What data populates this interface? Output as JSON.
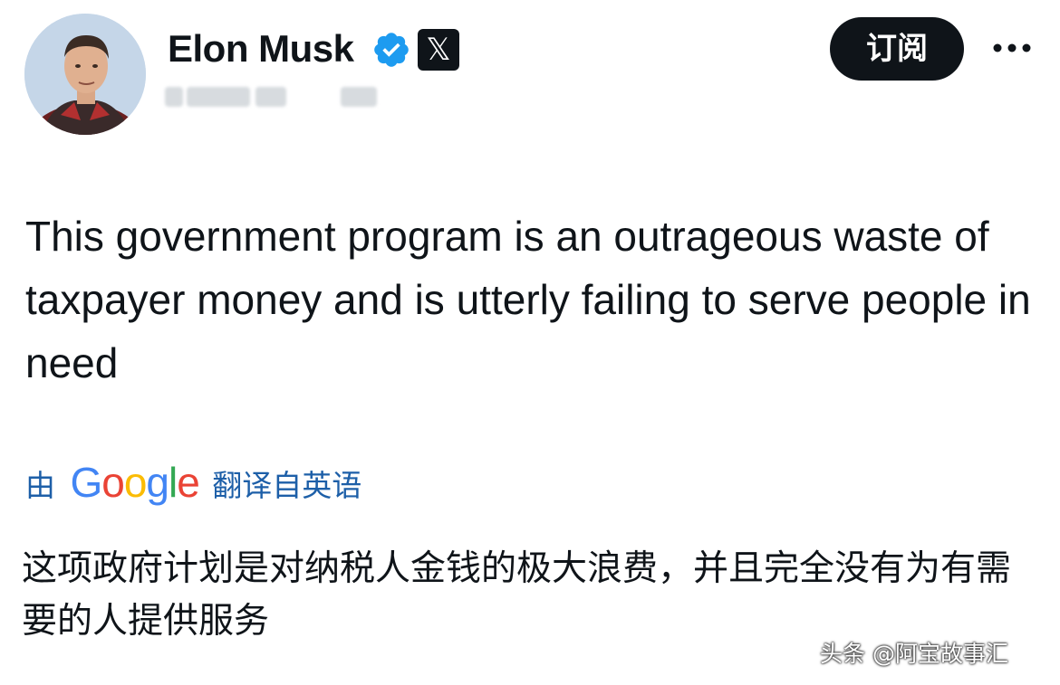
{
  "post": {
    "author": {
      "display_name": "Elon Musk",
      "verified_icon": "verified-badge-icon",
      "affiliation_badge_icon": "x-logo-icon",
      "affiliation_badge_glyph": "𝕏"
    },
    "subscribe_label": "订阅",
    "more_icon": "more-options-icon",
    "text": "This government program is an outrageous waste of taxpayer money and is utterly failing to serve people in need",
    "translation": {
      "by_label": "由",
      "provider_logo": "Google",
      "suffix_label": "翻译自英语",
      "text": "这项政府计划是对纳税人金钱的极大浪费，并且完全没有为有需要的人提供服务"
    }
  },
  "watermark": "头条 @阿宝故事汇",
  "colors": {
    "verified_blue": "#1d9bf0",
    "translate_link": "#1d5fa8",
    "button_bg": "#0f1419"
  }
}
